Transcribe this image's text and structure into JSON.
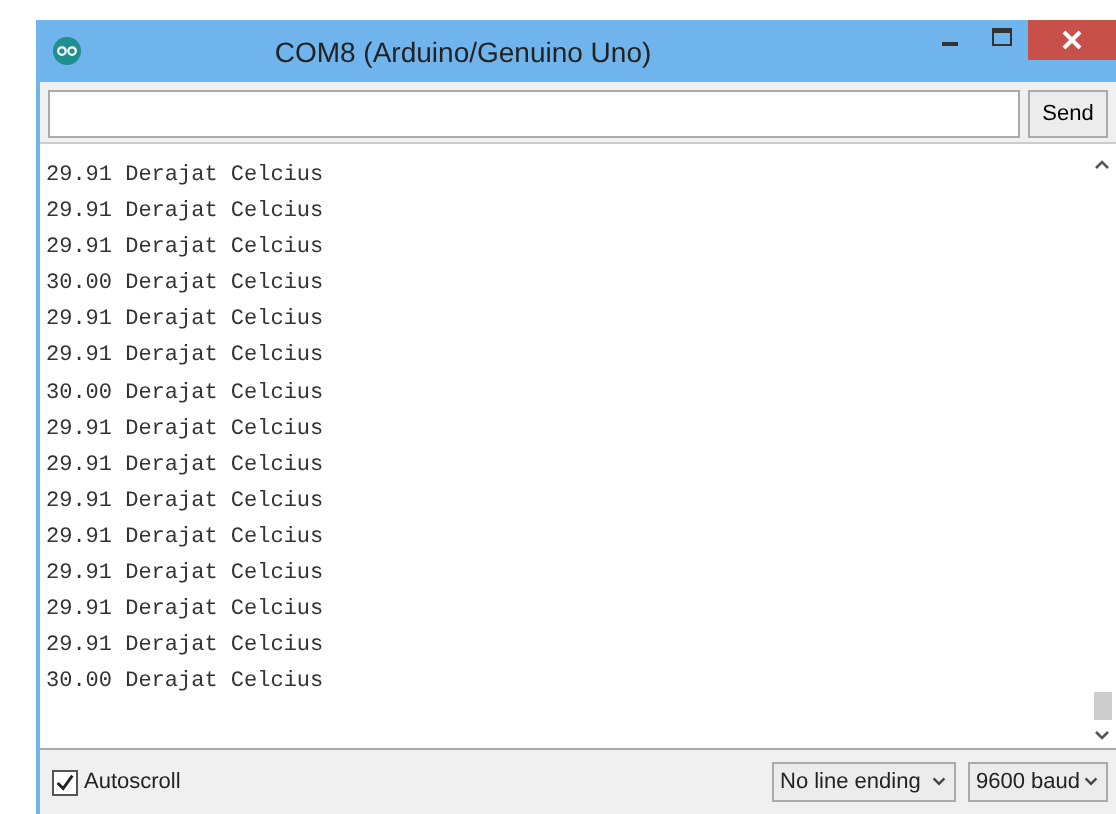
{
  "window": {
    "title": "COM8 (Arduino/Genuino Uno)"
  },
  "send_button": "Send",
  "output_lines": [
    "29.91 Derajat Celcius",
    "29.91 Derajat Celcius",
    "29.91 Derajat Celcius",
    "30.00 Derajat Celcius",
    "29.91 Derajat Celcius",
    "29.91 Derajat Celcius",
    "30.00 Derajat Celcius",
    "29.91 Derajat Celcius",
    "29.91 Derajat Celcius",
    "29.91 Derajat Celcius",
    "29.91 Derajat Celcius",
    "29.91 Derajat Celcius",
    "29.91 Derajat Celcius",
    "29.91 Derajat Celcius",
    "30.00 Derajat Celcius"
  ],
  "autoscroll": {
    "label": "Autoscroll",
    "checked": true
  },
  "line_ending": {
    "value": "No line ending"
  },
  "baud_rate": {
    "value": "9600 baud"
  }
}
